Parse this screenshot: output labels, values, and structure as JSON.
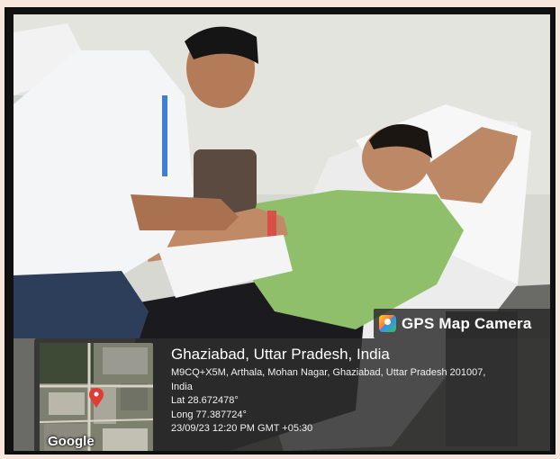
{
  "overlay": {
    "app_label": "GPS Map Camera",
    "map_brand": "Google",
    "location_title": "Ghaziabad, Uttar Pradesh, India",
    "address_line1": "M9CQ+X5M, Arthala, Mohan Nagar, Ghaziabad, Uttar Pradesh 201007,",
    "address_line2": "India",
    "latitude": "Lat 28.672478°",
    "longitude": "Long 77.387724°",
    "timestamp": "23/09/23 12:20 PM GMT +05:30"
  },
  "icons": [
    "gps-map-camera-icon",
    "map-pin-icon"
  ],
  "colors": {
    "panel_bg": "#2d2d2d",
    "pin": "#e53935",
    "shirt": "#8fbf6a",
    "coat": "#f4f5f7"
  }
}
